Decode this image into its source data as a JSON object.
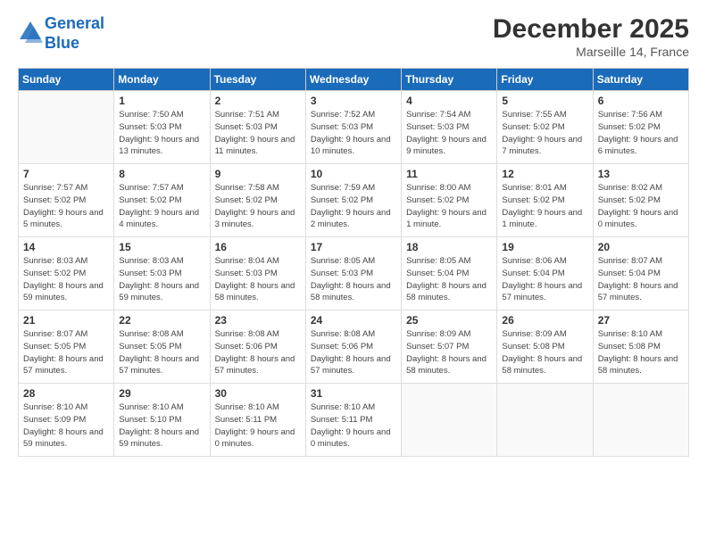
{
  "logo": {
    "line1": "General",
    "line2": "Blue"
  },
  "title": "December 2025",
  "location": "Marseille 14, France",
  "header_days": [
    "Sunday",
    "Monday",
    "Tuesday",
    "Wednesday",
    "Thursday",
    "Friday",
    "Saturday"
  ],
  "weeks": [
    [
      {
        "day": "",
        "sunrise": "",
        "sunset": "",
        "daylight": ""
      },
      {
        "day": "1",
        "sunrise": "Sunrise: 7:50 AM",
        "sunset": "Sunset: 5:03 PM",
        "daylight": "Daylight: 9 hours and 13 minutes."
      },
      {
        "day": "2",
        "sunrise": "Sunrise: 7:51 AM",
        "sunset": "Sunset: 5:03 PM",
        "daylight": "Daylight: 9 hours and 11 minutes."
      },
      {
        "day": "3",
        "sunrise": "Sunrise: 7:52 AM",
        "sunset": "Sunset: 5:03 PM",
        "daylight": "Daylight: 9 hours and 10 minutes."
      },
      {
        "day": "4",
        "sunrise": "Sunrise: 7:54 AM",
        "sunset": "Sunset: 5:03 PM",
        "daylight": "Daylight: 9 hours and 9 minutes."
      },
      {
        "day": "5",
        "sunrise": "Sunrise: 7:55 AM",
        "sunset": "Sunset: 5:02 PM",
        "daylight": "Daylight: 9 hours and 7 minutes."
      },
      {
        "day": "6",
        "sunrise": "Sunrise: 7:56 AM",
        "sunset": "Sunset: 5:02 PM",
        "daylight": "Daylight: 9 hours and 6 minutes."
      }
    ],
    [
      {
        "day": "7",
        "sunrise": "Sunrise: 7:57 AM",
        "sunset": "Sunset: 5:02 PM",
        "daylight": "Daylight: 9 hours and 5 minutes."
      },
      {
        "day": "8",
        "sunrise": "Sunrise: 7:57 AM",
        "sunset": "Sunset: 5:02 PM",
        "daylight": "Daylight: 9 hours and 4 minutes."
      },
      {
        "day": "9",
        "sunrise": "Sunrise: 7:58 AM",
        "sunset": "Sunset: 5:02 PM",
        "daylight": "Daylight: 9 hours and 3 minutes."
      },
      {
        "day": "10",
        "sunrise": "Sunrise: 7:59 AM",
        "sunset": "Sunset: 5:02 PM",
        "daylight": "Daylight: 9 hours and 2 minutes."
      },
      {
        "day": "11",
        "sunrise": "Sunrise: 8:00 AM",
        "sunset": "Sunset: 5:02 PM",
        "daylight": "Daylight: 9 hours and 1 minute."
      },
      {
        "day": "12",
        "sunrise": "Sunrise: 8:01 AM",
        "sunset": "Sunset: 5:02 PM",
        "daylight": "Daylight: 9 hours and 1 minute."
      },
      {
        "day": "13",
        "sunrise": "Sunrise: 8:02 AM",
        "sunset": "Sunset: 5:02 PM",
        "daylight": "Daylight: 9 hours and 0 minutes."
      }
    ],
    [
      {
        "day": "14",
        "sunrise": "Sunrise: 8:03 AM",
        "sunset": "Sunset: 5:02 PM",
        "daylight": "Daylight: 8 hours and 59 minutes."
      },
      {
        "day": "15",
        "sunrise": "Sunrise: 8:03 AM",
        "sunset": "Sunset: 5:03 PM",
        "daylight": "Daylight: 8 hours and 59 minutes."
      },
      {
        "day": "16",
        "sunrise": "Sunrise: 8:04 AM",
        "sunset": "Sunset: 5:03 PM",
        "daylight": "Daylight: 8 hours and 58 minutes."
      },
      {
        "day": "17",
        "sunrise": "Sunrise: 8:05 AM",
        "sunset": "Sunset: 5:03 PM",
        "daylight": "Daylight: 8 hours and 58 minutes."
      },
      {
        "day": "18",
        "sunrise": "Sunrise: 8:05 AM",
        "sunset": "Sunset: 5:04 PM",
        "daylight": "Daylight: 8 hours and 58 minutes."
      },
      {
        "day": "19",
        "sunrise": "Sunrise: 8:06 AM",
        "sunset": "Sunset: 5:04 PM",
        "daylight": "Daylight: 8 hours and 57 minutes."
      },
      {
        "day": "20",
        "sunrise": "Sunrise: 8:07 AM",
        "sunset": "Sunset: 5:04 PM",
        "daylight": "Daylight: 8 hours and 57 minutes."
      }
    ],
    [
      {
        "day": "21",
        "sunrise": "Sunrise: 8:07 AM",
        "sunset": "Sunset: 5:05 PM",
        "daylight": "Daylight: 8 hours and 57 minutes."
      },
      {
        "day": "22",
        "sunrise": "Sunrise: 8:08 AM",
        "sunset": "Sunset: 5:05 PM",
        "daylight": "Daylight: 8 hours and 57 minutes."
      },
      {
        "day": "23",
        "sunrise": "Sunrise: 8:08 AM",
        "sunset": "Sunset: 5:06 PM",
        "daylight": "Daylight: 8 hours and 57 minutes."
      },
      {
        "day": "24",
        "sunrise": "Sunrise: 8:08 AM",
        "sunset": "Sunset: 5:06 PM",
        "daylight": "Daylight: 8 hours and 57 minutes."
      },
      {
        "day": "25",
        "sunrise": "Sunrise: 8:09 AM",
        "sunset": "Sunset: 5:07 PM",
        "daylight": "Daylight: 8 hours and 58 minutes."
      },
      {
        "day": "26",
        "sunrise": "Sunrise: 8:09 AM",
        "sunset": "Sunset: 5:08 PM",
        "daylight": "Daylight: 8 hours and 58 minutes."
      },
      {
        "day": "27",
        "sunrise": "Sunrise: 8:10 AM",
        "sunset": "Sunset: 5:08 PM",
        "daylight": "Daylight: 8 hours and 58 minutes."
      }
    ],
    [
      {
        "day": "28",
        "sunrise": "Sunrise: 8:10 AM",
        "sunset": "Sunset: 5:09 PM",
        "daylight": "Daylight: 8 hours and 59 minutes."
      },
      {
        "day": "29",
        "sunrise": "Sunrise: 8:10 AM",
        "sunset": "Sunset: 5:10 PM",
        "daylight": "Daylight: 8 hours and 59 minutes."
      },
      {
        "day": "30",
        "sunrise": "Sunrise: 8:10 AM",
        "sunset": "Sunset: 5:11 PM",
        "daylight": "Daylight: 9 hours and 0 minutes."
      },
      {
        "day": "31",
        "sunrise": "Sunrise: 8:10 AM",
        "sunset": "Sunset: 5:11 PM",
        "daylight": "Daylight: 9 hours and 0 minutes."
      },
      {
        "day": "",
        "sunrise": "",
        "sunset": "",
        "daylight": ""
      },
      {
        "day": "",
        "sunrise": "",
        "sunset": "",
        "daylight": ""
      },
      {
        "day": "",
        "sunrise": "",
        "sunset": "",
        "daylight": ""
      }
    ]
  ]
}
